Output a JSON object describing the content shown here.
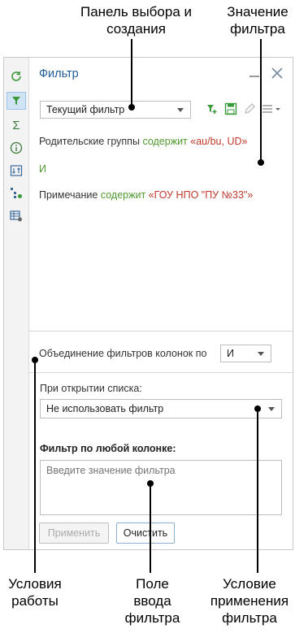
{
  "annotations": {
    "panel_label": "Панель выбора и создания",
    "value_label": "Значение фильтра",
    "conditions_label": "Условия работы",
    "input_label": "Поле ввода фильтра",
    "apply_condition_label": "Условие применения фильтра"
  },
  "toolbar": {
    "items": [
      "refresh-icon",
      "filter-icon",
      "sum-icon",
      "info-icon",
      "sort-icon",
      "tree-settings-icon",
      "grid-settings-icon"
    ]
  },
  "panel": {
    "title": "Фильтр",
    "filter_select": "Текущий фильтр",
    "conditions": [
      {
        "field": "Родительские группы",
        "operator": "содержит",
        "value": "«au/bu, UD»"
      },
      {
        "connector": "И"
      },
      {
        "field": "Примечание",
        "operator": "содержит",
        "value": "«ГОУ НПО \"ПУ №33\"»"
      }
    ],
    "combine_label": "Объединение фильтров колонок по",
    "combine_value": "И",
    "on_open_label": "При открытии списка:",
    "on_open_value": "Не использовать фильтр",
    "any_column_label": "Фильтр по любой колонке:",
    "any_column_placeholder": "Введите значение фильтра",
    "apply_button": "Применить",
    "clear_button": "Очистить"
  },
  "colors": {
    "accent": "#1f5a96",
    "operator": "#4e9a2d",
    "value": "#c0392b",
    "active_tool": "#cfe3f5"
  }
}
